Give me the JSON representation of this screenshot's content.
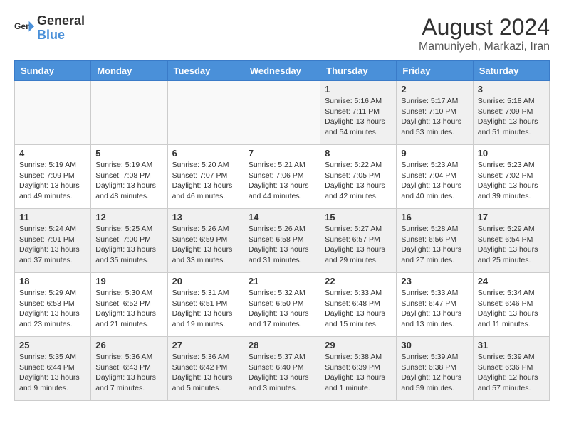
{
  "header": {
    "logo_line1": "General",
    "logo_line2": "Blue",
    "month_year": "August 2024",
    "location": "Mamuniyeh, Markazi, Iran"
  },
  "days_of_week": [
    "Sunday",
    "Monday",
    "Tuesday",
    "Wednesday",
    "Thursday",
    "Friday",
    "Saturday"
  ],
  "weeks": [
    [
      {
        "day": "",
        "info": ""
      },
      {
        "day": "",
        "info": ""
      },
      {
        "day": "",
        "info": ""
      },
      {
        "day": "",
        "info": ""
      },
      {
        "day": "1",
        "info": "Sunrise: 5:16 AM\nSunset: 7:11 PM\nDaylight: 13 hours\nand 54 minutes."
      },
      {
        "day": "2",
        "info": "Sunrise: 5:17 AM\nSunset: 7:10 PM\nDaylight: 13 hours\nand 53 minutes."
      },
      {
        "day": "3",
        "info": "Sunrise: 5:18 AM\nSunset: 7:09 PM\nDaylight: 13 hours\nand 51 minutes."
      }
    ],
    [
      {
        "day": "4",
        "info": "Sunrise: 5:19 AM\nSunset: 7:09 PM\nDaylight: 13 hours\nand 49 minutes."
      },
      {
        "day": "5",
        "info": "Sunrise: 5:19 AM\nSunset: 7:08 PM\nDaylight: 13 hours\nand 48 minutes."
      },
      {
        "day": "6",
        "info": "Sunrise: 5:20 AM\nSunset: 7:07 PM\nDaylight: 13 hours\nand 46 minutes."
      },
      {
        "day": "7",
        "info": "Sunrise: 5:21 AM\nSunset: 7:06 PM\nDaylight: 13 hours\nand 44 minutes."
      },
      {
        "day": "8",
        "info": "Sunrise: 5:22 AM\nSunset: 7:05 PM\nDaylight: 13 hours\nand 42 minutes."
      },
      {
        "day": "9",
        "info": "Sunrise: 5:23 AM\nSunset: 7:04 PM\nDaylight: 13 hours\nand 40 minutes."
      },
      {
        "day": "10",
        "info": "Sunrise: 5:23 AM\nSunset: 7:02 PM\nDaylight: 13 hours\nand 39 minutes."
      }
    ],
    [
      {
        "day": "11",
        "info": "Sunrise: 5:24 AM\nSunset: 7:01 PM\nDaylight: 13 hours\nand 37 minutes."
      },
      {
        "day": "12",
        "info": "Sunrise: 5:25 AM\nSunset: 7:00 PM\nDaylight: 13 hours\nand 35 minutes."
      },
      {
        "day": "13",
        "info": "Sunrise: 5:26 AM\nSunset: 6:59 PM\nDaylight: 13 hours\nand 33 minutes."
      },
      {
        "day": "14",
        "info": "Sunrise: 5:26 AM\nSunset: 6:58 PM\nDaylight: 13 hours\nand 31 minutes."
      },
      {
        "day": "15",
        "info": "Sunrise: 5:27 AM\nSunset: 6:57 PM\nDaylight: 13 hours\nand 29 minutes."
      },
      {
        "day": "16",
        "info": "Sunrise: 5:28 AM\nSunset: 6:56 PM\nDaylight: 13 hours\nand 27 minutes."
      },
      {
        "day": "17",
        "info": "Sunrise: 5:29 AM\nSunset: 6:54 PM\nDaylight: 13 hours\nand 25 minutes."
      }
    ],
    [
      {
        "day": "18",
        "info": "Sunrise: 5:29 AM\nSunset: 6:53 PM\nDaylight: 13 hours\nand 23 minutes."
      },
      {
        "day": "19",
        "info": "Sunrise: 5:30 AM\nSunset: 6:52 PM\nDaylight: 13 hours\nand 21 minutes."
      },
      {
        "day": "20",
        "info": "Sunrise: 5:31 AM\nSunset: 6:51 PM\nDaylight: 13 hours\nand 19 minutes."
      },
      {
        "day": "21",
        "info": "Sunrise: 5:32 AM\nSunset: 6:50 PM\nDaylight: 13 hours\nand 17 minutes."
      },
      {
        "day": "22",
        "info": "Sunrise: 5:33 AM\nSunset: 6:48 PM\nDaylight: 13 hours\nand 15 minutes."
      },
      {
        "day": "23",
        "info": "Sunrise: 5:33 AM\nSunset: 6:47 PM\nDaylight: 13 hours\nand 13 minutes."
      },
      {
        "day": "24",
        "info": "Sunrise: 5:34 AM\nSunset: 6:46 PM\nDaylight: 13 hours\nand 11 minutes."
      }
    ],
    [
      {
        "day": "25",
        "info": "Sunrise: 5:35 AM\nSunset: 6:44 PM\nDaylight: 13 hours\nand 9 minutes."
      },
      {
        "day": "26",
        "info": "Sunrise: 5:36 AM\nSunset: 6:43 PM\nDaylight: 13 hours\nand 7 minutes."
      },
      {
        "day": "27",
        "info": "Sunrise: 5:36 AM\nSunset: 6:42 PM\nDaylight: 13 hours\nand 5 minutes."
      },
      {
        "day": "28",
        "info": "Sunrise: 5:37 AM\nSunset: 6:40 PM\nDaylight: 13 hours\nand 3 minutes."
      },
      {
        "day": "29",
        "info": "Sunrise: 5:38 AM\nSunset: 6:39 PM\nDaylight: 13 hours\nand 1 minute."
      },
      {
        "day": "30",
        "info": "Sunrise: 5:39 AM\nSunset: 6:38 PM\nDaylight: 12 hours\nand 59 minutes."
      },
      {
        "day": "31",
        "info": "Sunrise: 5:39 AM\nSunset: 6:36 PM\nDaylight: 12 hours\nand 57 minutes."
      }
    ]
  ]
}
